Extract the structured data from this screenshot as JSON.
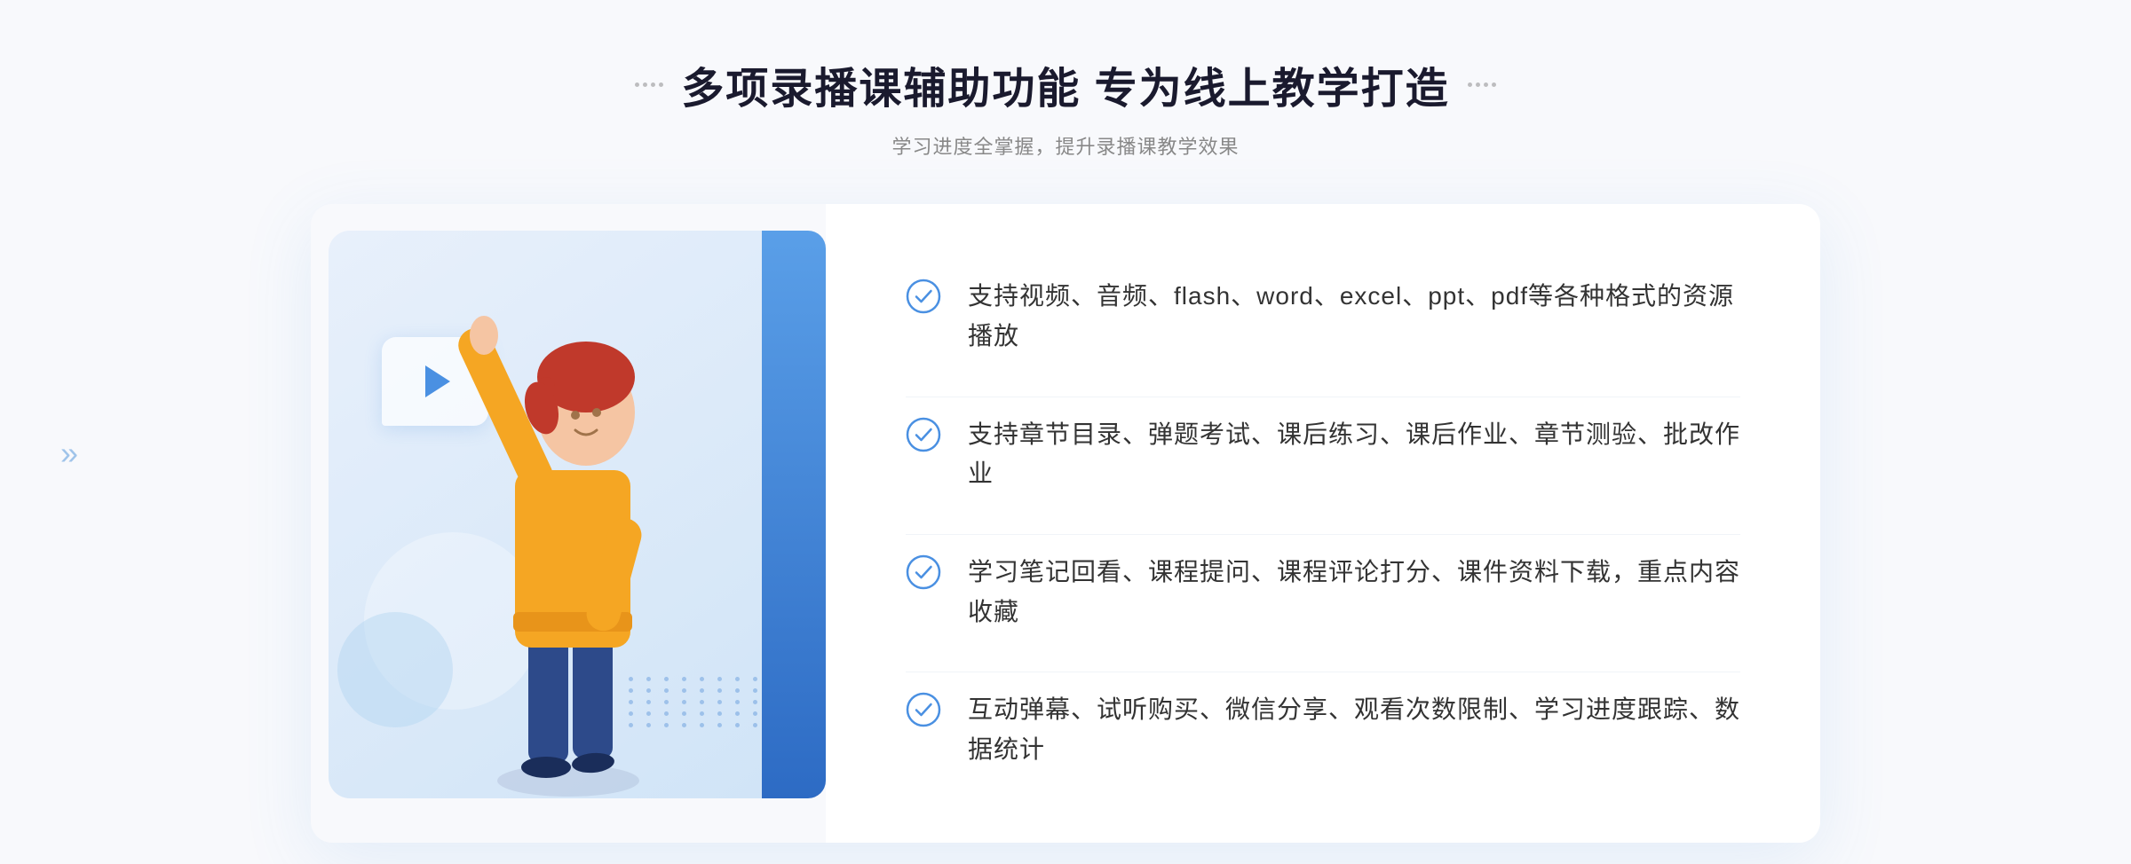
{
  "header": {
    "title": "多项录播课辅助功能 专为线上教学打造",
    "subtitle": "学习进度全掌握，提升录播课教学效果",
    "title_deco_left": "decoration-left",
    "title_deco_right": "decoration-right"
  },
  "features": [
    {
      "id": 1,
      "text": "支持视频、音频、flash、word、excel、ppt、pdf等各种格式的资源播放"
    },
    {
      "id": 2,
      "text": "支持章节目录、弹题考试、课后练习、课后作业、章节测验、批改作业"
    },
    {
      "id": 3,
      "text": "学习笔记回看、课程提问、课程评论打分、课件资料下载，重点内容收藏"
    },
    {
      "id": 4,
      "text": "互动弹幕、试听购买、微信分享、观看次数限制、学习进度跟踪、数据统计"
    }
  ],
  "colors": {
    "accent_blue": "#4a90e2",
    "dark_blue": "#2d6bc4",
    "text_dark": "#333333",
    "text_gray": "#888888",
    "bg_light": "#f8f9fc",
    "check_color": "#4a90e2"
  }
}
